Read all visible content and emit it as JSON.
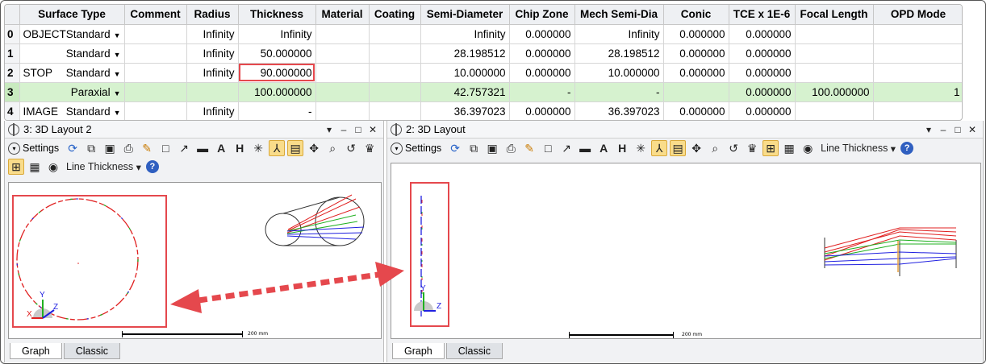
{
  "table": {
    "columns": [
      "",
      "Surface Type",
      "Comment",
      "Radius",
      "Thickness",
      "Material",
      "Coating",
      "Semi-Diameter",
      "Chip Zone",
      "Mech Semi-Dia",
      "Conic",
      "TCE x 1E-6",
      "Focal Length",
      "OPD Mode"
    ],
    "rows": [
      {
        "num": "0",
        "name": "OBJECT",
        "type": "Standard",
        "comment": "",
        "radius": "Infinity",
        "thickness": "Infinity",
        "material": "",
        "coating": "",
        "semi": "Infinity",
        "chip": "0.000000",
        "mech": "Infinity",
        "conic": "0.000000",
        "tce": "0.000000",
        "focal": "",
        "opd": ""
      },
      {
        "num": "1",
        "name": "",
        "type": "Standard",
        "comment": "",
        "radius": "Infinity",
        "thickness": "50.000000",
        "material": "",
        "coating": "",
        "semi": "28.198512",
        "chip": "0.000000",
        "mech": "28.198512",
        "conic": "0.000000",
        "tce": "0.000000",
        "focal": "",
        "opd": ""
      },
      {
        "num": "2",
        "name": "STOP",
        "type": "Standard",
        "comment": "",
        "radius": "Infinity",
        "thickness": "90.000000",
        "material": "",
        "coating": "",
        "semi": "10.000000",
        "chip": "0.000000",
        "mech": "10.000000",
        "conic": "0.000000",
        "tce": "0.000000",
        "focal": "",
        "opd": ""
      },
      {
        "num": "3",
        "name": "",
        "type": "Paraxial",
        "comment": "",
        "radius": "",
        "thickness": "100.000000",
        "material": "",
        "coating": "",
        "semi": "42.757321",
        "chip": "-",
        "mech": "-",
        "conic": "",
        "tce": "0.000000",
        "focal": "100.000000",
        "opd": "1"
      },
      {
        "num": "4",
        "name": "IMAGE",
        "type": "Standard",
        "comment": "",
        "radius": "Infinity",
        "thickness": "-",
        "material": "",
        "coating": "",
        "semi": "36.397023",
        "chip": "0.000000",
        "mech": "36.397023",
        "conic": "0.000000",
        "tce": "0.000000",
        "focal": "",
        "opd": ""
      }
    ]
  },
  "left_window": {
    "title": "3: 3D Layout 2",
    "settings_label": "Settings",
    "line_thickness_label": "Line Thickness",
    "tabs": [
      "Graph",
      "Classic"
    ],
    "axis_labels": {
      "y": "Y",
      "x": "X",
      "z": "Z"
    }
  },
  "right_window": {
    "title": "2: 3D Layout",
    "settings_label": "Settings",
    "line_thickness_label": "Line Thickness",
    "tabs": [
      "Graph",
      "Classic"
    ],
    "axis_labels": {
      "y": "Y",
      "z": "Z"
    }
  },
  "window_buttons": {
    "menu": "▾",
    "minimize": "–",
    "maximize": "□",
    "close": "✕"
  },
  "colors": {
    "highlight_row": "#d6f2cf",
    "annotation_red": "#e5484d",
    "active_tool": "#f9dc8a",
    "ray_red": "#e02020",
    "ray_green": "#20b020",
    "ray_blue": "#2020e0"
  }
}
